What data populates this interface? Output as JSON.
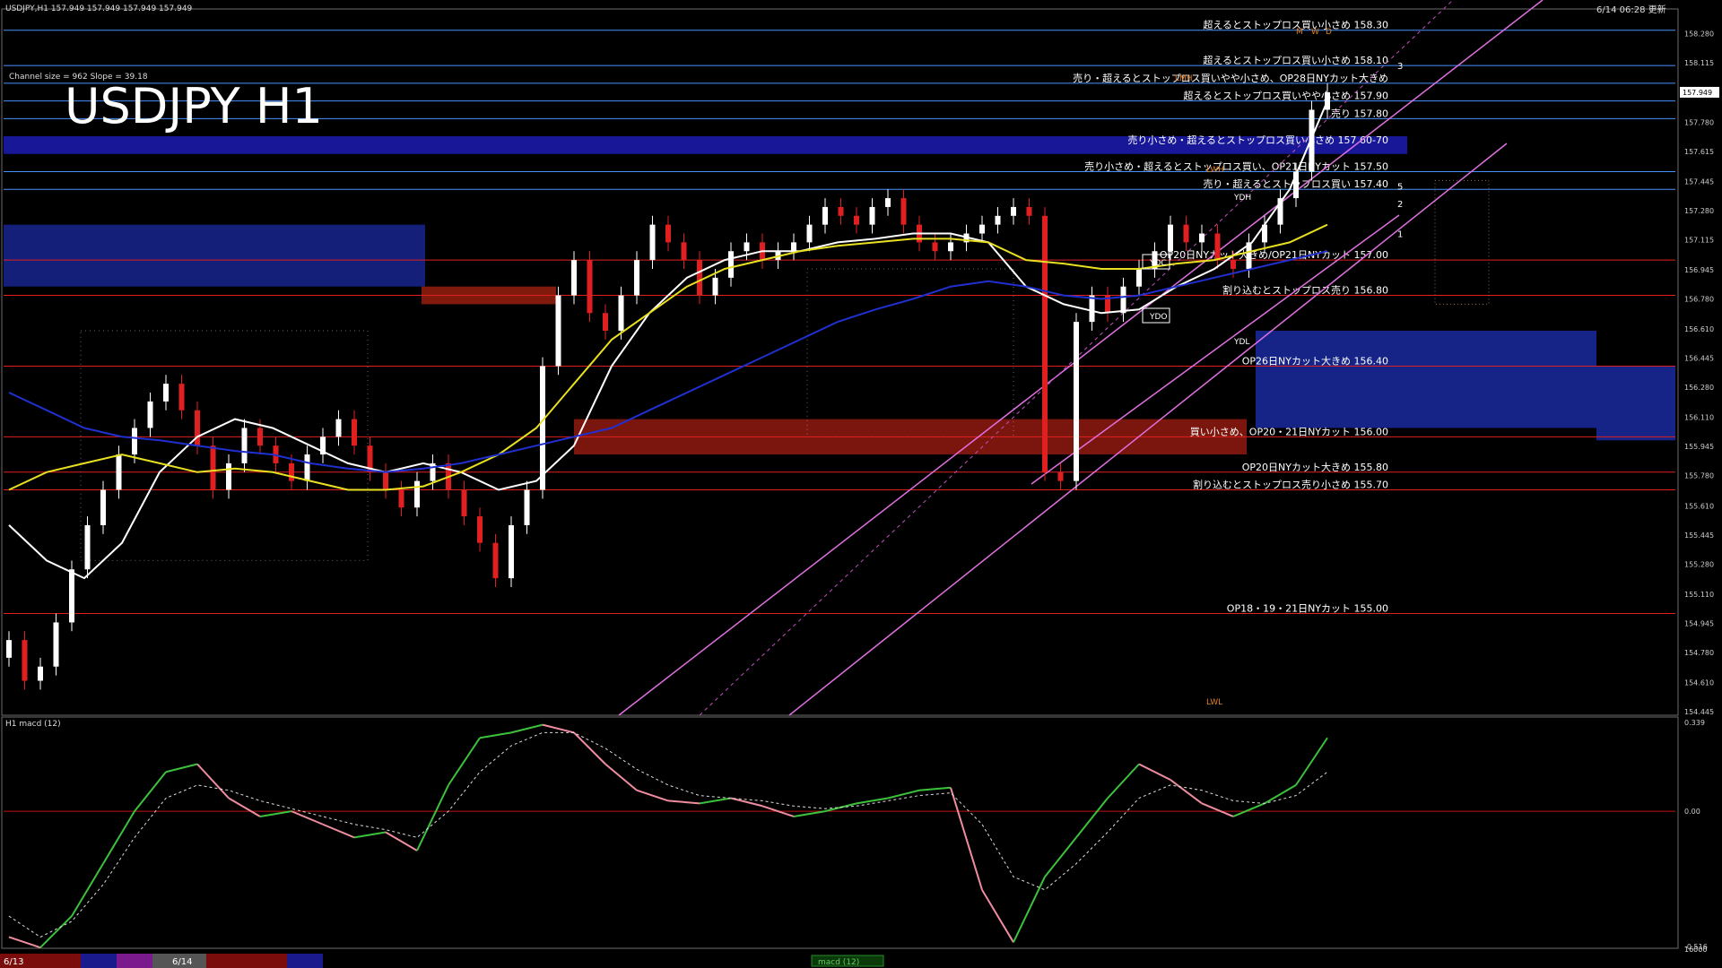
{
  "header": {
    "symbol_info": "USDJPY,H1  157.949 157.949 157.949 157.949",
    "datetime": "6/14 06:28 更新",
    "channel_info": "Channel size = 962 Slope = 39.18",
    "big_title": "USDJPY H1"
  },
  "chart_data": [
    {
      "type": "line",
      "title": "USDJPY H1",
      "ylim": [
        154.44,
        158.4
      ],
      "y_ticks": [
        "158.280",
        "158.115",
        "157.949",
        "157.780",
        "157.615",
        "157.445",
        "157.280",
        "157.115",
        "156.945",
        "156.780",
        "156.610",
        "156.445",
        "156.280",
        "156.110",
        "155.945",
        "155.780",
        "155.610",
        "155.445",
        "155.280",
        "155.110",
        "154.945",
        "154.780",
        "154.610",
        "154.445"
      ],
      "current_price": "157.949",
      "levels": [
        {
          "label": "超えるとストップロス買い小さめ 158.30",
          "value": 158.3,
          "color": "#4a90ff"
        },
        {
          "label": "超えるとストップロス買い小さめ 158.10",
          "value": 158.1,
          "color": "#4a90ff"
        },
        {
          "label": "売り・超えるとストップロス買いやや小さめ、OP28日NYカット大きめ",
          "value": 158.0,
          "color": "#4a90ff"
        },
        {
          "label": "超えるとストップロス買いやや小さめ 157.90",
          "value": 157.9,
          "color": "#4a90ff"
        },
        {
          "label": "売り 157.80",
          "value": 157.8,
          "color": "#4a90ff"
        },
        {
          "label": "売り小さめ・超えるとストップロス買い小さめ 157.60-70",
          "value": 157.65,
          "color": "#2030d0"
        },
        {
          "label": "売り小さめ・超えるとストップロス買い、OP21日NYカット 157.50",
          "value": 157.5,
          "color": "#4a90ff"
        },
        {
          "label": "売り・超えるとストップロス買い 157.40",
          "value": 157.4,
          "color": "#4a90ff"
        },
        {
          "label": "OP20日NYカット大きめ/OP21日NYカット 157.00",
          "value": 157.0,
          "color": "#e02020"
        },
        {
          "label": "割り込むとストップロス売り 156.80",
          "value": 156.8,
          "color": "#e02020"
        },
        {
          "label": "OP26日NYカット大きめ 156.40",
          "value": 156.4,
          "color": "#e02020"
        },
        {
          "label": "買い小さめ、OP20・21日NYカット 156.00",
          "value": 156.0,
          "color": "#e02020"
        },
        {
          "label": "OP20日NYカット大きめ 155.80",
          "value": 155.8,
          "color": "#e02020"
        },
        {
          "label": "割り込むとストップロス売り小さめ 155.70",
          "value": 155.7,
          "color": "#e02020"
        },
        {
          "label": "OP18・19・21日NYカット 155.00",
          "value": 155.0,
          "color": "#e02020"
        }
      ],
      "marker_labels": [
        "YDC",
        "YDO",
        "YDL",
        "YDH",
        "LWH",
        "LWL",
        "LMH",
        "M",
        "W",
        "D"
      ],
      "channel_labels": [
        "3",
        "5",
        "2",
        "1"
      ],
      "candles": [
        154.85,
        154.62,
        154.7,
        154.95,
        155.25,
        155.5,
        155.7,
        155.9,
        156.05,
        156.2,
        156.3,
        156.15,
        155.95,
        155.7,
        155.85,
        156.05,
        155.95,
        155.85,
        155.75,
        155.9,
        156.0,
        156.1,
        155.95,
        155.8,
        155.7,
        155.6,
        155.75,
        155.85,
        155.7,
        155.55,
        155.4,
        155.2,
        155.5,
        155.7,
        156.4,
        156.8,
        157.0,
        156.7,
        156.6,
        156.8,
        157.0,
        157.2,
        157.1,
        157.0,
        156.8,
        156.9,
        157.05,
        157.1,
        157.0,
        157.05,
        157.1,
        157.2,
        157.3,
        157.25,
        157.2,
        157.3,
        157.35,
        157.2,
        157.1,
        157.05,
        157.1,
        157.15,
        157.2,
        157.25,
        157.3,
        157.25,
        155.8,
        155.75,
        156.65,
        156.8,
        156.7,
        156.85,
        156.95,
        157.05,
        157.2,
        157.1,
        157.15,
        157.0,
        156.95,
        157.1,
        157.2,
        157.35,
        157.5,
        157.85,
        157.949
      ],
      "series": [
        {
          "values": [
            155.5,
            155.3,
            155.2,
            155.4,
            155.8,
            156.0,
            156.1,
            156.05,
            155.95,
            155.85,
            155.8,
            155.85,
            155.8,
            155.7,
            155.75,
            155.95,
            156.4,
            156.7,
            156.9,
            157.0,
            157.05,
            157.05,
            157.1,
            157.12,
            157.15,
            157.15,
            157.1,
            156.85,
            156.75,
            156.7,
            156.72,
            156.85,
            156.95,
            157.1,
            157.4,
            157.9
          ]
        },
        {
          "values": [
            155.7,
            155.8,
            155.85,
            155.9,
            155.85,
            155.8,
            155.82,
            155.8,
            155.75,
            155.7,
            155.7,
            155.72,
            155.8,
            155.9,
            156.05,
            156.3,
            156.55,
            156.7,
            156.85,
            156.95,
            157.0,
            157.05,
            157.08,
            157.1,
            157.12,
            157.12,
            157.1,
            157.0,
            156.98,
            156.95,
            156.95,
            156.98,
            157.0,
            157.05,
            157.1,
            157.2
          ]
        },
        {
          "values": [
            156.25,
            156.15,
            156.05,
            156.0,
            155.98,
            155.95,
            155.92,
            155.9,
            155.85,
            155.82,
            155.8,
            155.82,
            155.85,
            155.9,
            155.95,
            156.0,
            156.05,
            156.15,
            156.25,
            156.35,
            156.45,
            156.55,
            156.65,
            156.72,
            156.78,
            156.85,
            156.88,
            156.85,
            156.8,
            156.78,
            156.8,
            156.85,
            156.9,
            156.95,
            157.0,
            157.05
          ]
        }
      ],
      "macd": {
        "label": "H1 macd (12)",
        "ylim": [
          -0.516,
          0.339
        ],
        "y_ticks": [
          "0.339",
          "0.00",
          "-0.516"
        ],
        "values": [
          -0.48,
          -0.52,
          -0.4,
          -0.2,
          0.0,
          0.15,
          0.18,
          0.05,
          -0.02,
          0.0,
          -0.05,
          -0.1,
          -0.08,
          -0.15,
          0.1,
          0.28,
          0.3,
          0.33,
          0.3,
          0.18,
          0.08,
          0.04,
          0.03,
          0.05,
          0.02,
          -0.02,
          0.0,
          0.03,
          0.05,
          0.08,
          0.09,
          -0.3,
          -0.5,
          -0.25,
          -0.1,
          0.05,
          0.18,
          0.12,
          0.03,
          -0.02,
          0.03,
          0.1,
          0.28
        ],
        "signal": [
          -0.4,
          -0.48,
          -0.42,
          -0.28,
          -0.1,
          0.05,
          0.1,
          0.08,
          0.04,
          0.01,
          -0.02,
          -0.05,
          -0.07,
          -0.1,
          0.0,
          0.15,
          0.25,
          0.3,
          0.3,
          0.24,
          0.16,
          0.1,
          0.06,
          0.05,
          0.04,
          0.02,
          0.01,
          0.02,
          0.04,
          0.06,
          0.07,
          -0.05,
          -0.25,
          -0.3,
          -0.2,
          -0.08,
          0.05,
          0.1,
          0.08,
          0.04,
          0.03,
          0.06,
          0.15
        ]
      }
    }
  ],
  "bottom_bar": {
    "date1": "6/13",
    "date2": "6/14",
    "indicator": "macd (12)"
  },
  "axis_extra": "16000"
}
